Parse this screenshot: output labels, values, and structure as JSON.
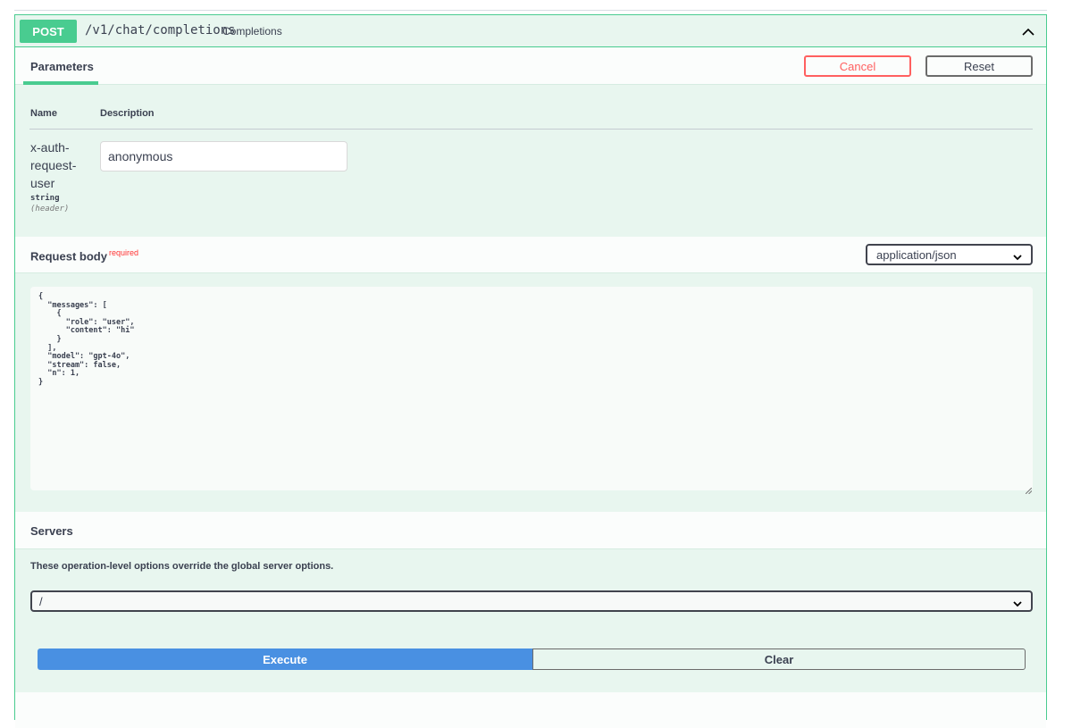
{
  "operation": {
    "method": "POST",
    "path": "/v1/chat/completions",
    "summary": "Completions",
    "collapse_icon": "chevron-up-icon"
  },
  "parameters_section": {
    "tab_label": "Parameters",
    "cancel_label": "Cancel",
    "reset_label": "Reset",
    "column_name": "Name",
    "column_description": "Description"
  },
  "parameter": {
    "name": "x-auth-request-user",
    "type": "string",
    "location": "(header)",
    "value": "anonymous"
  },
  "request_body": {
    "title": "Request body",
    "required_label": "required",
    "content_type": "application/json",
    "content": "{\n  \"messages\": [\n    {\n      \"role\": \"user\",\n      \"content\": \"hi\"\n    }\n  ],\n  \"model\": \"gpt-4o\",\n  \"stream\": false,\n  \"n\": 1,\n}"
  },
  "servers": {
    "title": "Servers",
    "note": "These operation-level options override the global server options.",
    "selected": "/"
  },
  "actions": {
    "execute_label": "Execute",
    "clear_label": "Clear"
  },
  "colors": {
    "post_green": "#49cc90",
    "block_bg": "#e8f6ef",
    "cancel_red": "#ff6060",
    "execute_blue": "#4990e2"
  }
}
